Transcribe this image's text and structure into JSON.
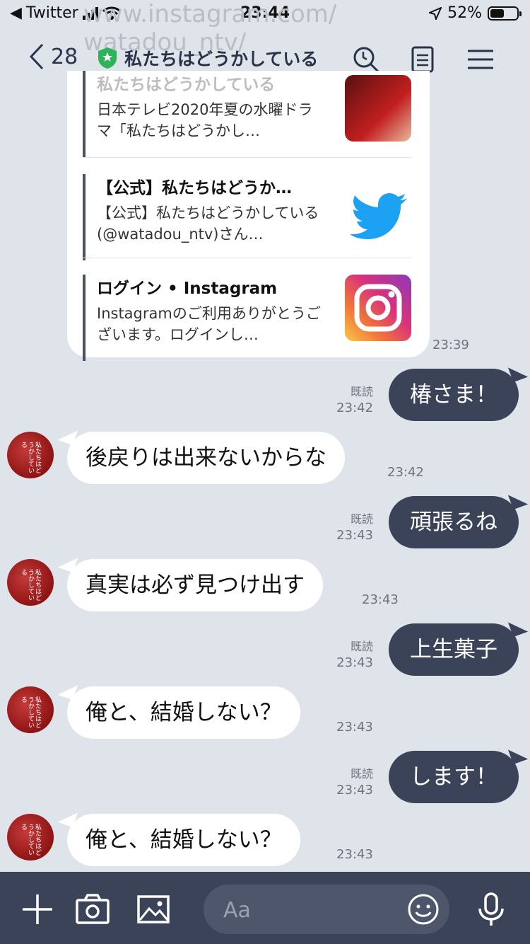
{
  "status_bar": {
    "carrier": "Twitter",
    "time": "23:44",
    "battery": "52%",
    "battery_level": 0.52
  },
  "ghost_url": {
    "line1": "www.instagram.com/",
    "line2": "watadou_ntv/"
  },
  "header": {
    "back_count": "28",
    "title": "私たちはどうかしている"
  },
  "link_card": {
    "items": [
      {
        "title": "私たちはどうかしている",
        "desc": "日本テレビ2020年夏の水曜ドラマ「私たちはどうかし…",
        "thumb": "drama-poster"
      },
      {
        "title": "【公式】私たちはどうか…",
        "desc": "【公式】私たちはどうかしている (@watadou_ntv)さん…",
        "thumb": "twitter-logo"
      },
      {
        "title": "ログイン • Instagram",
        "desc": "Instagramのご利用ありがとうございます。ログインし…",
        "thumb": "instagram-logo"
      }
    ],
    "time": "23:39"
  },
  "messages": [
    {
      "side": "sent",
      "text": "椿さま！",
      "time": "23:42",
      "read": "既読"
    },
    {
      "side": "recv",
      "text": "後戻りは出来ないからな",
      "time": "23:42"
    },
    {
      "side": "sent",
      "text": "頑張るね",
      "time": "23:43",
      "read": "既読"
    },
    {
      "side": "recv",
      "text": "真実は必ず見つけ出す",
      "time": "23:43"
    },
    {
      "side": "sent",
      "text": "上生菓子",
      "time": "23:43",
      "read": "既読"
    },
    {
      "side": "recv",
      "text": "俺と、結婚しない？",
      "time": "23:43"
    },
    {
      "side": "sent",
      "text": "します！",
      "time": "23:43",
      "read": "既読"
    },
    {
      "side": "recv",
      "text": "俺と、結婚しない？",
      "time": "23:43"
    }
  ],
  "avatar_text": "私たちはどうかしている",
  "input": {
    "placeholder": "Aa"
  },
  "colors": {
    "background": "#dfe3ea",
    "sent_bubble": "#3a4357",
    "bottom_bar": "#3a4357",
    "shield": "#2fb35a"
  }
}
